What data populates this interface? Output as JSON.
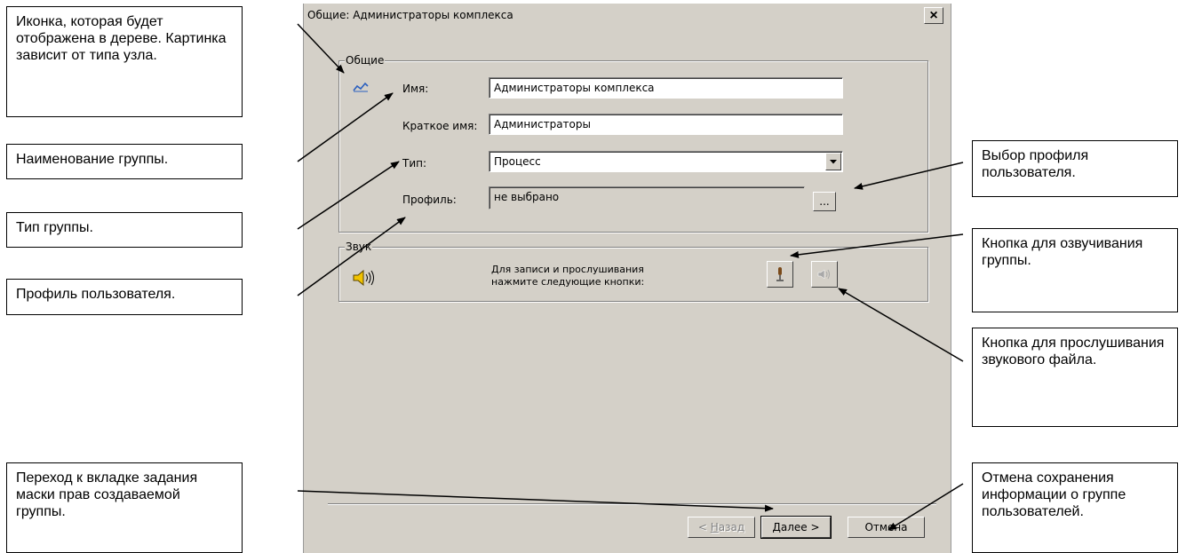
{
  "dialog": {
    "title": "Общие: Администраторы комплекса",
    "close": "×",
    "general_group": {
      "label": "Общие",
      "name_label": "Имя:",
      "name_value": "Администраторы комплекса",
      "short_name_label": "Краткое имя:",
      "short_name_value": "Администраторы",
      "type_label": "Тип:",
      "type_value": "Процесс",
      "profile_label": "Профиль:",
      "profile_value": "не выбрано",
      "profile_button": "..."
    },
    "sound_group": {
      "label": "Звук",
      "hint_line1": "Для записи и прослушивания",
      "hint_line2": "нажмите следующие кнопки:"
    },
    "buttons": {
      "back_prefix": "< ",
      "back_hotkey": "Н",
      "back_rest": "азад",
      "next_hotkey": "Д",
      "next_rest": "алее >",
      "cancel": "Отмена"
    }
  },
  "callouts": {
    "icon": "Иконка, которая будет отображена в дереве. Картинка зависит от типа узла.",
    "name": "Наименование группы.",
    "type": "Тип группы.",
    "profile": "Профиль пользователя.",
    "profile_select": "Выбор профиля пользователя.",
    "record": "Кнопка для озвучивания группы.",
    "play": "Кнопка для прослушивания звукового файла.",
    "next": "Переход к вкладке задания маски прав создаваемой группы.",
    "cancel": "Отмена сохранения информации о группе пользователей."
  },
  "icons": {
    "group": "group-icon",
    "speaker": "speaker-icon",
    "record": "microphone-icon",
    "play": "play-sound-icon",
    "dropdown": "chevron-down-icon"
  }
}
